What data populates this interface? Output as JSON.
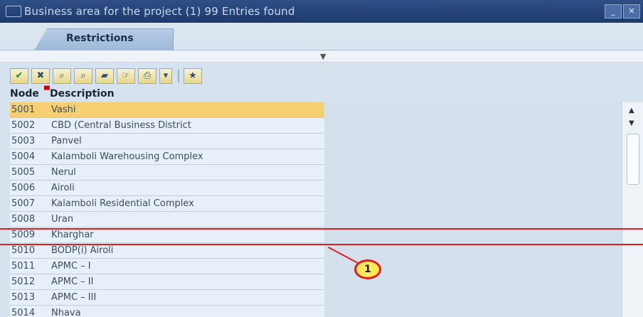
{
  "window": {
    "title": "Business area for the project (1)   99 Entries found",
    "minimize_label": "_",
    "close_label": "✕"
  },
  "tabs": [
    {
      "label": "Restrictions"
    }
  ],
  "splitter_grip": "▼",
  "toolbar": {
    "buttons": [
      {
        "icon": "check-icon",
        "glyph": "✔"
      },
      {
        "icon": "cancel-icon",
        "glyph": "✖"
      },
      {
        "icon": "find-icon",
        "glyph": "⌕"
      },
      {
        "icon": "find-next-icon",
        "glyph": "⌕"
      },
      {
        "icon": "folder-icon",
        "glyph": "▰"
      },
      {
        "icon": "choose-icon",
        "glyph": "☞"
      },
      {
        "icon": "print-icon",
        "glyph": "⎙"
      },
      {
        "icon": "dropdown-icon",
        "glyph": "▾"
      },
      {
        "icon": "info-icon",
        "glyph": "★"
      }
    ]
  },
  "columns": {
    "node": "Node",
    "description": "Description"
  },
  "rows": [
    {
      "code": "5001",
      "desc": "Vashi",
      "selected": true
    },
    {
      "code": "5002",
      "desc": "CBD (Central Business District"
    },
    {
      "code": "5003",
      "desc": "Panvel"
    },
    {
      "code": "5004",
      "desc": "Kalamboli Warehousing Complex"
    },
    {
      "code": "5005",
      "desc": "Nerul"
    },
    {
      "code": "5006",
      "desc": "Airoli"
    },
    {
      "code": "5007",
      "desc": "Kalamboli Residential Complex"
    },
    {
      "code": "5008",
      "desc": "Uran"
    },
    {
      "code": "5009",
      "desc": "Kharghar"
    },
    {
      "code": "5010",
      "desc": "BODP(i) Airoli"
    },
    {
      "code": "5011",
      "desc": "APMC – I"
    },
    {
      "code": "5012",
      "desc": "APMC – II"
    },
    {
      "code": "5013",
      "desc": "APMC – III"
    },
    {
      "code": "5014",
      "desc": "Nhava"
    }
  ],
  "scrollbar": {
    "up": "▲",
    "down": "▼"
  },
  "callout": {
    "label": "1"
  },
  "colors": {
    "highlight": "#e11d1d",
    "selected_row": "#f5cf71",
    "callout_fill": "#ffe95a"
  }
}
